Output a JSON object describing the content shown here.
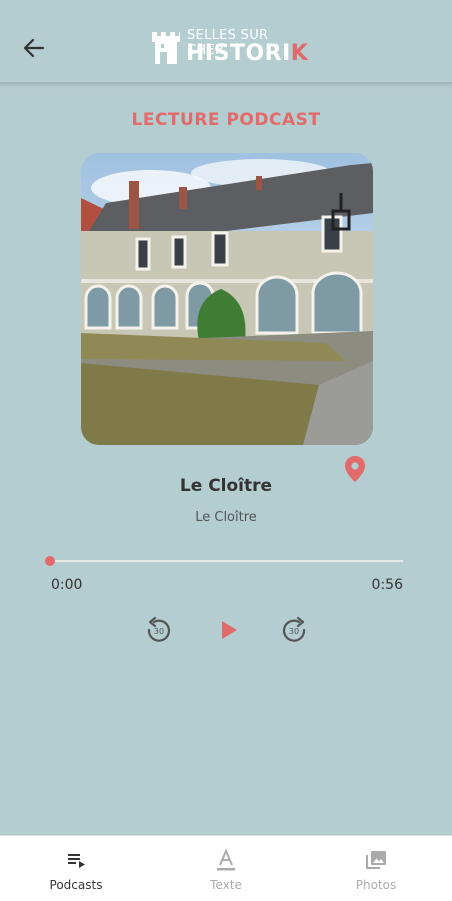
{
  "header": {
    "logo_top": "SELLES SUR CHER",
    "logo_main": "HISTORI",
    "logo_accent": "K"
  },
  "page": {
    "section_title": "LECTURE PODCAST"
  },
  "track": {
    "title": "Le Cloître",
    "subtitle": "Le Cloître",
    "time_current": "0:00",
    "time_total": "0:56",
    "progress": 0.0
  },
  "nav": [
    {
      "label": "Podcasts",
      "active": true
    },
    {
      "label": "Texte",
      "active": false
    },
    {
      "label": "Photos",
      "active": false
    }
  ],
  "colors": {
    "background": "#b4cdd0",
    "accent": "#e36a6a",
    "active_nav": "#333333",
    "inactive_nav": "#aaaaaa"
  }
}
